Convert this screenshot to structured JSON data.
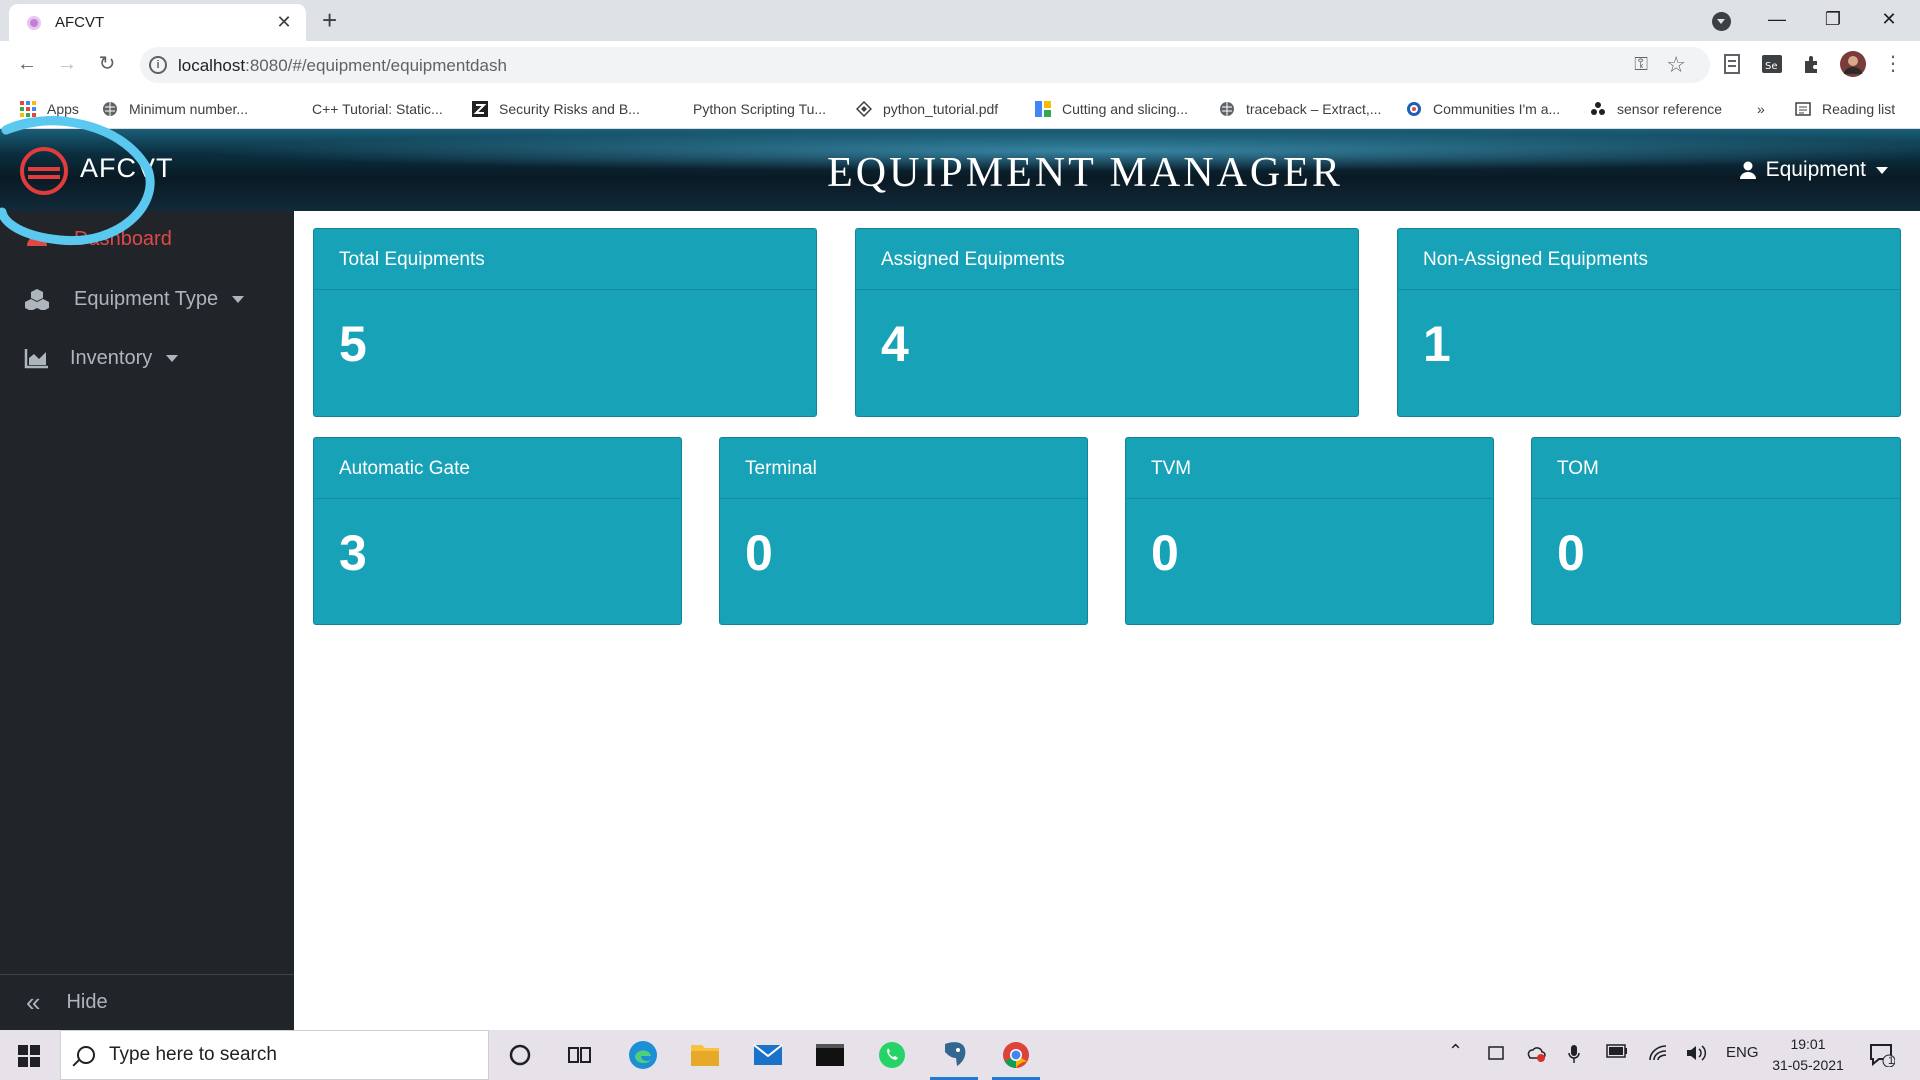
{
  "browser": {
    "tab_title": "AFCVT",
    "tab_close": "✕",
    "new_tab": "+",
    "url_host": "localhost",
    "url_rest": ":8080/#/equipment/equipmentdash",
    "bookmarks": [
      {
        "label": "Apps",
        "icon": "apps-grid-icon"
      },
      {
        "label": "Minimum number...",
        "icon": "globe-icon"
      },
      {
        "label": "C++ Tutorial: Static...",
        "icon": "none"
      },
      {
        "label": "Security Risks and B...",
        "icon": "zotero-icon"
      },
      {
        "label": "Python Scripting Tu...",
        "icon": "none"
      },
      {
        "label": "python_tutorial.pdf",
        "icon": "diamond-icon"
      },
      {
        "label": "Cutting and slicing...",
        "icon": "colab-icon"
      },
      {
        "label": "traceback – Extract,...",
        "icon": "globe-icon"
      },
      {
        "label": "Communities I'm a...",
        "icon": "stackexchange-icon"
      },
      {
        "label": "sensor reference",
        "icon": "network-icon"
      }
    ],
    "more_bookmarks": "»",
    "reading_list": "Reading list"
  },
  "header": {
    "brand": "AFCVT",
    "title": "EQUIPMENT MANAGER",
    "user_menu": "Equipment"
  },
  "sidebar": {
    "items": [
      {
        "label": "Dashboard",
        "icon": "dashboard-icon",
        "active": true
      },
      {
        "label": "Equipment Type",
        "icon": "cubes-icon",
        "has_dropdown": true
      },
      {
        "label": "Inventory",
        "icon": "chart-area-icon",
        "has_dropdown": true
      }
    ],
    "hide_label": "Hide"
  },
  "cards_top": [
    {
      "title": "Total Equipments",
      "value": "5"
    },
    {
      "title": "Assigned Equipments",
      "value": "4"
    },
    {
      "title": "Non-Assigned Equipments",
      "value": "1"
    }
  ],
  "cards_bottom": [
    {
      "title": "Automatic Gate",
      "value": "3"
    },
    {
      "title": "Terminal",
      "value": "0"
    },
    {
      "title": "TVM",
      "value": "0"
    },
    {
      "title": "TOM",
      "value": "0"
    }
  ],
  "colors": {
    "card": "#17a2b8",
    "sidebar": "#212529",
    "active_link": "#e04848",
    "annotation": "#5bc8f0"
  },
  "taskbar": {
    "search_placeholder": "Type here to search",
    "language": "ENG",
    "time": "19:01",
    "date": "31-05-2021",
    "notifications": "1"
  }
}
